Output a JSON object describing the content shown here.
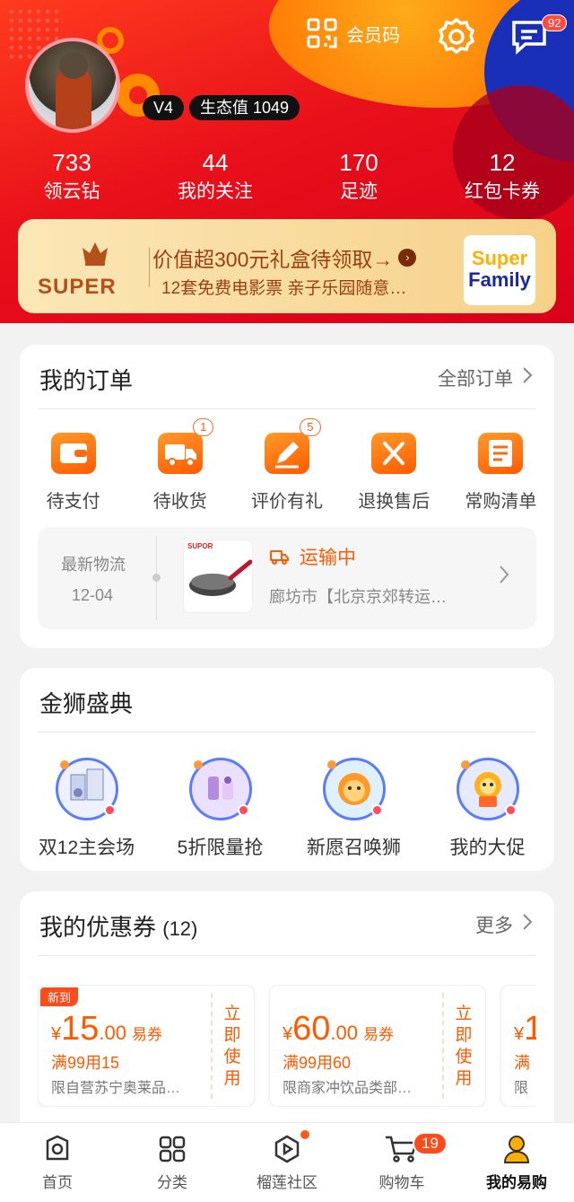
{
  "header": {
    "member_code_label": "会员码",
    "message_count": "92",
    "level_badge": "V4",
    "eco_value": "生态值 1049"
  },
  "stats": [
    {
      "value": "733",
      "label": "领云钻"
    },
    {
      "value": "44",
      "label": "我的关注"
    },
    {
      "value": "170",
      "label": "足迹"
    },
    {
      "value": "12",
      "label": "红包卡券"
    }
  ],
  "super_banner": {
    "logo_text": "SUPER",
    "line1": "价值超300元礼盒待领取→",
    "line2": "12套免费电影票 亲子乐园随意…",
    "card_line1": "Super",
    "card_line2": "Family"
  },
  "orders": {
    "title": "我的订单",
    "more": "全部订单",
    "items": [
      {
        "label": "待支付",
        "count": "",
        "icon": "wallet-icon"
      },
      {
        "label": "待收货",
        "count": "1",
        "icon": "truck-icon"
      },
      {
        "label": "评价有礼",
        "count": "5",
        "icon": "pen-icon"
      },
      {
        "label": "退换售后",
        "count": "",
        "icon": "tools-icon"
      },
      {
        "label": "常购清单",
        "count": "",
        "icon": "list-icon"
      }
    ],
    "logistics": {
      "title": "最新物流",
      "date": "12-04",
      "status": "运输中",
      "desc": "廊坊市【北京京郊转运…",
      "product_brand": "SUPOR"
    }
  },
  "golden_lion": {
    "title": "金狮盛典",
    "items": [
      {
        "label": "双12主会场"
      },
      {
        "label": "5折限量抢"
      },
      {
        "label": "新愿召唤狮"
      },
      {
        "label": "我的大促"
      }
    ]
  },
  "coupons": {
    "title": "我的优惠券",
    "count": "(12)",
    "more": "更多",
    "items": [
      {
        "tag": "新到",
        "symbol": "¥",
        "int": "15",
        "dec": ".00",
        "unit": "易券",
        "condition": "满99用15",
        "desc": "限自营苏宁奥莱品…",
        "action": "立即使用"
      },
      {
        "tag": "",
        "symbol": "¥",
        "int": "60",
        "dec": ".00",
        "unit": "易券",
        "condition": "满99用60",
        "desc": "限商家冲饮品类部…",
        "action": "立即使用"
      },
      {
        "tag": "",
        "symbol": "¥",
        "int": "1",
        "dec": "",
        "unit": "",
        "condition": "满",
        "desc": "限",
        "action": ""
      }
    ]
  },
  "tabbar": [
    {
      "label": "首页",
      "icon": "home-icon"
    },
    {
      "label": "分类",
      "icon": "category-icon"
    },
    {
      "label": "榴莲社区",
      "icon": "play-community-icon"
    },
    {
      "label": "购物车",
      "icon": "cart-icon",
      "count": "19"
    },
    {
      "label": "我的易购",
      "icon": "user-icon"
    }
  ],
  "colors": {
    "brand_red": "#e8101a",
    "accent_orange": "#ff5a00"
  }
}
